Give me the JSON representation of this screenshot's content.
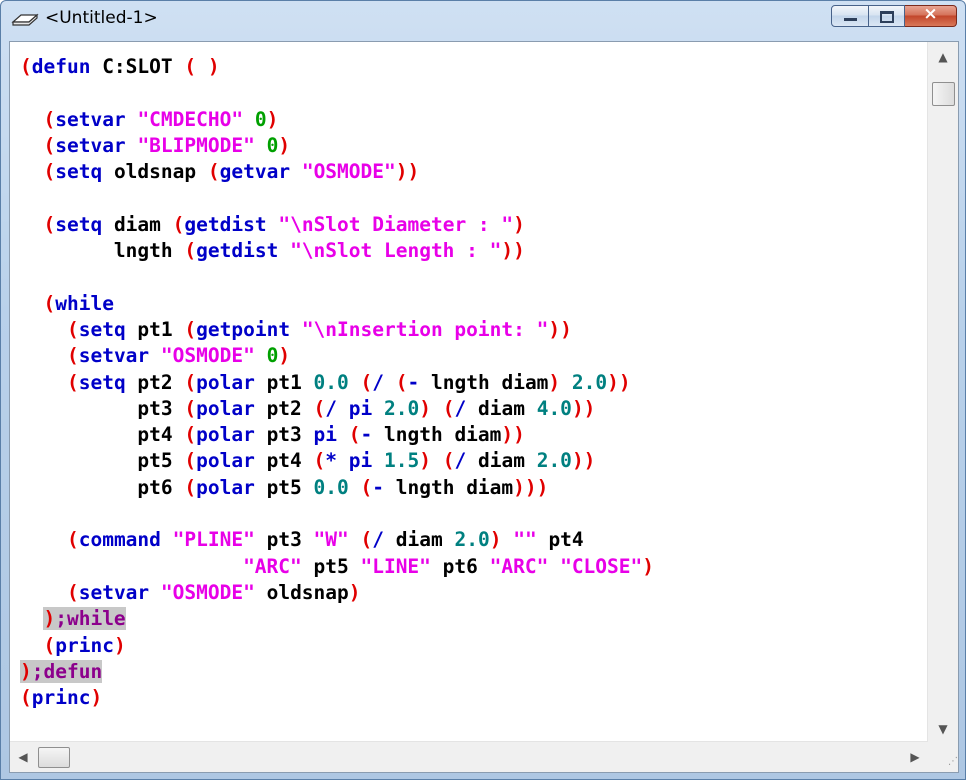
{
  "window": {
    "title": "<Untitled-1>",
    "close_glyph": "×",
    "icons": {
      "app": "eraser-icon",
      "minimize": "minimize-icon",
      "maximize": "maximize-icon",
      "close": "close-icon"
    }
  },
  "editor": {
    "colors": {
      "paren": "#e00000",
      "keyword": "#0000c8",
      "string": "#e800e8",
      "number": "#008080",
      "zero": "#00a000",
      "comment": "#8c008c"
    },
    "lines": [
      [
        {
          "t": "p",
          "v": "("
        },
        {
          "t": "k",
          "v": "defun"
        },
        {
          "t": "x",
          "v": " C:SLOT "
        },
        {
          "t": "p",
          "v": "( )"
        }
      ],
      [],
      [
        {
          "t": "x",
          "v": "  "
        },
        {
          "t": "p",
          "v": "("
        },
        {
          "t": "k",
          "v": "setvar"
        },
        {
          "t": "x",
          "v": " "
        },
        {
          "t": "s",
          "v": "\"CMDECHO\""
        },
        {
          "t": "x",
          "v": " "
        },
        {
          "t": "z",
          "v": "0"
        },
        {
          "t": "p",
          "v": ")"
        }
      ],
      [
        {
          "t": "x",
          "v": "  "
        },
        {
          "t": "p",
          "v": "("
        },
        {
          "t": "k",
          "v": "setvar"
        },
        {
          "t": "x",
          "v": " "
        },
        {
          "t": "s",
          "v": "\"BLIPMODE\""
        },
        {
          "t": "x",
          "v": " "
        },
        {
          "t": "z",
          "v": "0"
        },
        {
          "t": "p",
          "v": ")"
        }
      ],
      [
        {
          "t": "x",
          "v": "  "
        },
        {
          "t": "p",
          "v": "("
        },
        {
          "t": "k",
          "v": "setq"
        },
        {
          "t": "x",
          "v": " oldsnap "
        },
        {
          "t": "p",
          "v": "("
        },
        {
          "t": "k",
          "v": "getvar"
        },
        {
          "t": "x",
          "v": " "
        },
        {
          "t": "s",
          "v": "\"OSMODE\""
        },
        {
          "t": "p",
          "v": "))"
        }
      ],
      [],
      [
        {
          "t": "x",
          "v": "  "
        },
        {
          "t": "p",
          "v": "("
        },
        {
          "t": "k",
          "v": "setq"
        },
        {
          "t": "x",
          "v": " diam "
        },
        {
          "t": "p",
          "v": "("
        },
        {
          "t": "k",
          "v": "getdist"
        },
        {
          "t": "x",
          "v": " "
        },
        {
          "t": "s",
          "v": "\"\\nSlot Diameter : \""
        },
        {
          "t": "p",
          "v": ")"
        }
      ],
      [
        {
          "t": "x",
          "v": "        lngth "
        },
        {
          "t": "p",
          "v": "("
        },
        {
          "t": "k",
          "v": "getdist"
        },
        {
          "t": "x",
          "v": " "
        },
        {
          "t": "s",
          "v": "\"\\nSlot Length : \""
        },
        {
          "t": "p",
          "v": "))"
        }
      ],
      [],
      [
        {
          "t": "x",
          "v": "  "
        },
        {
          "t": "p",
          "v": "("
        },
        {
          "t": "k",
          "v": "while"
        }
      ],
      [
        {
          "t": "x",
          "v": "    "
        },
        {
          "t": "p",
          "v": "("
        },
        {
          "t": "k",
          "v": "setq"
        },
        {
          "t": "x",
          "v": " pt1 "
        },
        {
          "t": "p",
          "v": "("
        },
        {
          "t": "k",
          "v": "getpoint"
        },
        {
          "t": "x",
          "v": " "
        },
        {
          "t": "s",
          "v": "\"\\nInsertion point: \""
        },
        {
          "t": "p",
          "v": "))"
        }
      ],
      [
        {
          "t": "x",
          "v": "    "
        },
        {
          "t": "p",
          "v": "("
        },
        {
          "t": "k",
          "v": "setvar"
        },
        {
          "t": "x",
          "v": " "
        },
        {
          "t": "s",
          "v": "\"OSMODE\""
        },
        {
          "t": "x",
          "v": " "
        },
        {
          "t": "z",
          "v": "0"
        },
        {
          "t": "p",
          "v": ")"
        }
      ],
      [
        {
          "t": "x",
          "v": "    "
        },
        {
          "t": "p",
          "v": "("
        },
        {
          "t": "k",
          "v": "setq"
        },
        {
          "t": "x",
          "v": " pt2 "
        },
        {
          "t": "p",
          "v": "("
        },
        {
          "t": "k",
          "v": "polar"
        },
        {
          "t": "x",
          "v": " pt1 "
        },
        {
          "t": "n",
          "v": "0.0"
        },
        {
          "t": "x",
          "v": " "
        },
        {
          "t": "p",
          "v": "("
        },
        {
          "t": "k",
          "v": "/"
        },
        {
          "t": "x",
          "v": " "
        },
        {
          "t": "p",
          "v": "("
        },
        {
          "t": "k",
          "v": "-"
        },
        {
          "t": "x",
          "v": " lngth diam"
        },
        {
          "t": "p",
          "v": ")"
        },
        {
          "t": "x",
          "v": " "
        },
        {
          "t": "n",
          "v": "2.0"
        },
        {
          "t": "p",
          "v": "))"
        }
      ],
      [
        {
          "t": "x",
          "v": "          pt3 "
        },
        {
          "t": "p",
          "v": "("
        },
        {
          "t": "k",
          "v": "polar"
        },
        {
          "t": "x",
          "v": " pt2 "
        },
        {
          "t": "p",
          "v": "("
        },
        {
          "t": "k",
          "v": "/"
        },
        {
          "t": "x",
          "v": " "
        },
        {
          "t": "k",
          "v": "pi"
        },
        {
          "t": "x",
          "v": " "
        },
        {
          "t": "n",
          "v": "2.0"
        },
        {
          "t": "p",
          "v": ")"
        },
        {
          "t": "x",
          "v": " "
        },
        {
          "t": "p",
          "v": "("
        },
        {
          "t": "k",
          "v": "/"
        },
        {
          "t": "x",
          "v": " diam "
        },
        {
          "t": "n",
          "v": "4.0"
        },
        {
          "t": "p",
          "v": "))"
        }
      ],
      [
        {
          "t": "x",
          "v": "          pt4 "
        },
        {
          "t": "p",
          "v": "("
        },
        {
          "t": "k",
          "v": "polar"
        },
        {
          "t": "x",
          "v": " pt3 "
        },
        {
          "t": "k",
          "v": "pi"
        },
        {
          "t": "x",
          "v": " "
        },
        {
          "t": "p",
          "v": "("
        },
        {
          "t": "k",
          "v": "-"
        },
        {
          "t": "x",
          "v": " lngth diam"
        },
        {
          "t": "p",
          "v": "))"
        }
      ],
      [
        {
          "t": "x",
          "v": "          pt5 "
        },
        {
          "t": "p",
          "v": "("
        },
        {
          "t": "k",
          "v": "polar"
        },
        {
          "t": "x",
          "v": " pt4 "
        },
        {
          "t": "p",
          "v": "("
        },
        {
          "t": "k",
          "v": "*"
        },
        {
          "t": "x",
          "v": " "
        },
        {
          "t": "k",
          "v": "pi"
        },
        {
          "t": "x",
          "v": " "
        },
        {
          "t": "n",
          "v": "1.5"
        },
        {
          "t": "p",
          "v": ")"
        },
        {
          "t": "x",
          "v": " "
        },
        {
          "t": "p",
          "v": "("
        },
        {
          "t": "k",
          "v": "/"
        },
        {
          "t": "x",
          "v": " diam "
        },
        {
          "t": "n",
          "v": "2.0"
        },
        {
          "t": "p",
          "v": "))"
        }
      ],
      [
        {
          "t": "x",
          "v": "          pt6 "
        },
        {
          "t": "p",
          "v": "("
        },
        {
          "t": "k",
          "v": "polar"
        },
        {
          "t": "x",
          "v": " pt5 "
        },
        {
          "t": "n",
          "v": "0.0"
        },
        {
          "t": "x",
          "v": " "
        },
        {
          "t": "p",
          "v": "("
        },
        {
          "t": "k",
          "v": "-"
        },
        {
          "t": "x",
          "v": " lngth diam"
        },
        {
          "t": "p",
          "v": ")))"
        }
      ],
      [],
      [
        {
          "t": "x",
          "v": "    "
        },
        {
          "t": "p",
          "v": "("
        },
        {
          "t": "k",
          "v": "command"
        },
        {
          "t": "x",
          "v": " "
        },
        {
          "t": "s",
          "v": "\"PLINE\""
        },
        {
          "t": "x",
          "v": " pt3 "
        },
        {
          "t": "s",
          "v": "\"W\""
        },
        {
          "t": "x",
          "v": " "
        },
        {
          "t": "p",
          "v": "("
        },
        {
          "t": "k",
          "v": "/"
        },
        {
          "t": "x",
          "v": " diam "
        },
        {
          "t": "n",
          "v": "2.0"
        },
        {
          "t": "p",
          "v": ")"
        },
        {
          "t": "x",
          "v": " "
        },
        {
          "t": "s",
          "v": "\"\""
        },
        {
          "t": "x",
          "v": " pt4"
        }
      ],
      [
        {
          "t": "x",
          "v": "                   "
        },
        {
          "t": "s",
          "v": "\"ARC\""
        },
        {
          "t": "x",
          "v": " pt5 "
        },
        {
          "t": "s",
          "v": "\"LINE\""
        },
        {
          "t": "x",
          "v": " pt6 "
        },
        {
          "t": "s",
          "v": "\"ARC\""
        },
        {
          "t": "x",
          "v": " "
        },
        {
          "t": "s",
          "v": "\"CLOSE\""
        },
        {
          "t": "p",
          "v": ")"
        }
      ],
      [
        {
          "t": "x",
          "v": "    "
        },
        {
          "t": "p",
          "v": "("
        },
        {
          "t": "k",
          "v": "setvar"
        },
        {
          "t": "x",
          "v": " "
        },
        {
          "t": "s",
          "v": "\"OSMODE\""
        },
        {
          "t": "x",
          "v": " oldsnap"
        },
        {
          "t": "p",
          "v": ")"
        }
      ],
      [
        {
          "t": "x",
          "v": "  "
        },
        {
          "t": "pm",
          "v": ")"
        },
        {
          "t": "c",
          "v": ";while"
        }
      ],
      [
        {
          "t": "x",
          "v": "  "
        },
        {
          "t": "p",
          "v": "("
        },
        {
          "t": "k",
          "v": "princ"
        },
        {
          "t": "p",
          "v": ")"
        }
      ],
      [
        {
          "t": "pm",
          "v": ")"
        },
        {
          "t": "c",
          "v": ";defun"
        }
      ],
      [
        {
          "t": "p",
          "v": "("
        },
        {
          "t": "k",
          "v": "princ"
        },
        {
          "t": "p",
          "v": ")"
        }
      ]
    ]
  },
  "scrollbars": {
    "up_arrow": "▲",
    "down_arrow": "▼",
    "left_arrow": "◀",
    "right_arrow": "▶",
    "grip": "⋰"
  }
}
